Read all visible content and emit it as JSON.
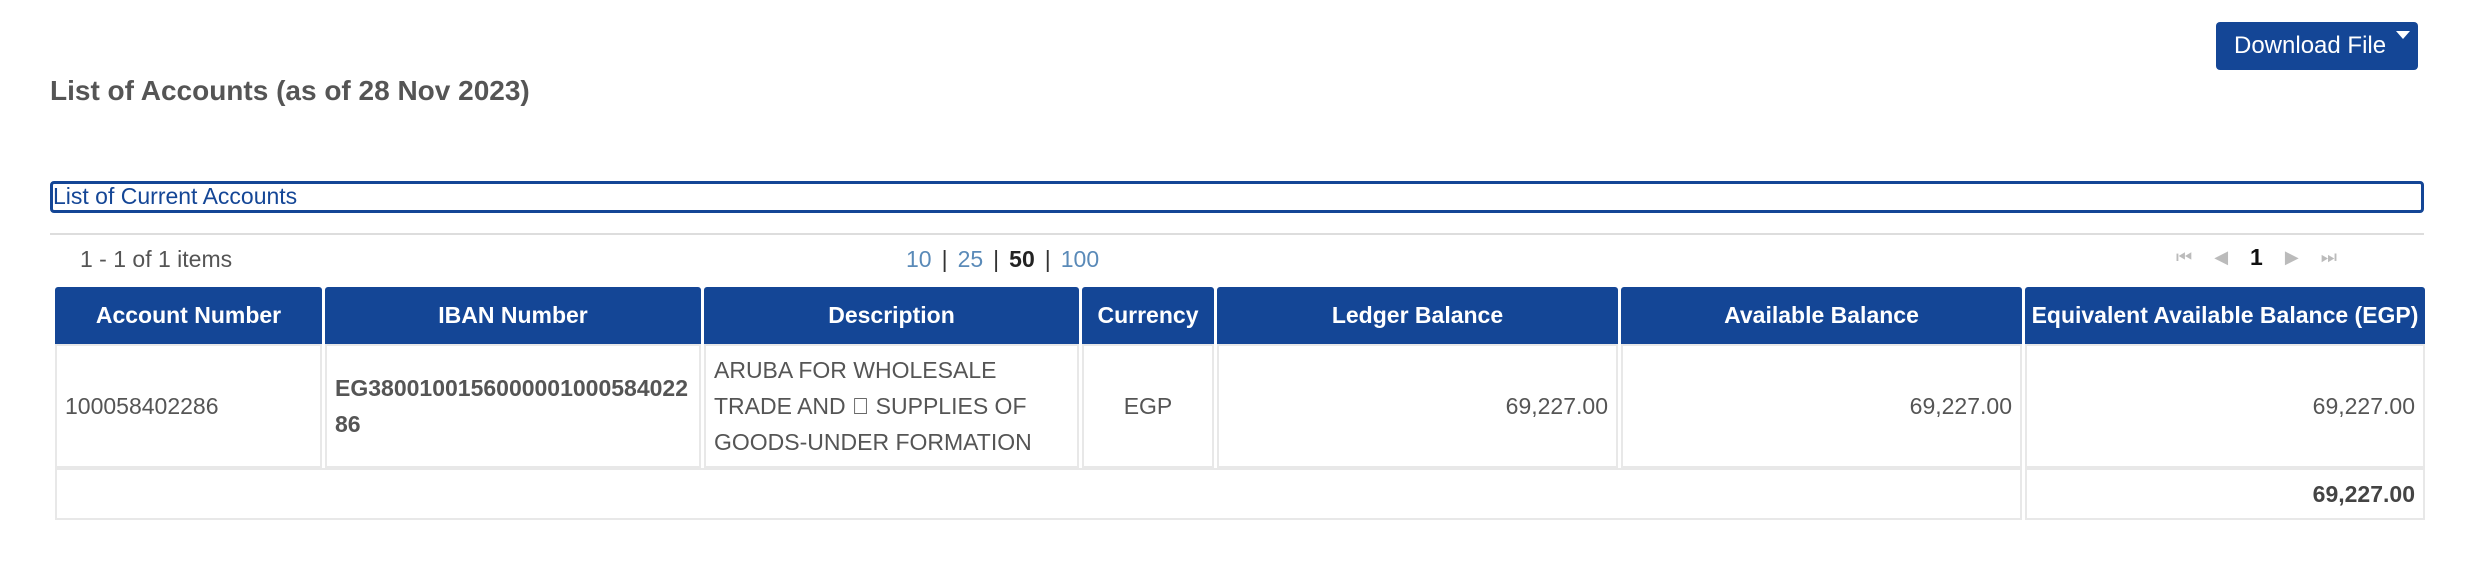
{
  "header": {
    "download_label": "Download File",
    "title": "List of Accounts (as of 28 Nov 2023)"
  },
  "section": {
    "tab_label": "List of Current Accounts"
  },
  "pager": {
    "info": "1 - 1 of 1 items",
    "page_sizes": [
      "10",
      "25",
      "50",
      "100"
    ],
    "active_page_size": "50",
    "current_page": "1",
    "separator": "|"
  },
  "table": {
    "columns": [
      "Account Number",
      "IBAN Number",
      "Description",
      "Currency",
      "Ledger Balance",
      "Available Balance",
      "Equivalent Available Balance (EGP)"
    ],
    "rows": [
      {
        "account_number": "100058402286",
        "iban": "EG380010015600000100058402286",
        "description": "ARUBA FOR WHOLESALE TRADE AND \u0000 SUPPLIES OF GOODS-UNDER FORMATION",
        "currency": "EGP",
        "ledger_balance": "69,227.00",
        "available_balance": "69,227.00",
        "equivalent_balance": "69,227.00"
      }
    ],
    "total": "69,227.00"
  },
  "colors": {
    "header_blue": "#144696",
    "link_blue": "#5a8ab8"
  }
}
